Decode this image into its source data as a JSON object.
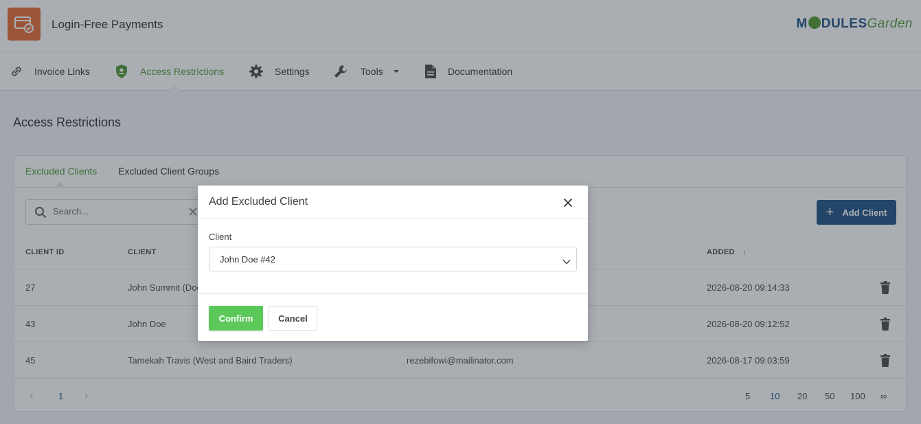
{
  "header": {
    "app_title": "Login-Free Payments",
    "brand_left": "M",
    "brand_mid": "DULES",
    "brand_right": "Garden"
  },
  "nav": {
    "items": [
      {
        "label": "Invoice Links",
        "icon": "link-icon"
      },
      {
        "label": "Access Restrictions",
        "icon": "shield-user-icon",
        "active": true
      },
      {
        "label": "Settings",
        "icon": "gear-icon"
      },
      {
        "label": "Tools",
        "icon": "wrench-icon",
        "dropdown": true
      },
      {
        "label": "Documentation",
        "icon": "document-icon"
      }
    ]
  },
  "page_title": "Access Restrictions",
  "tabs": [
    {
      "label": "Excluded Clients",
      "active": true
    },
    {
      "label": "Excluded Client Groups"
    }
  ],
  "search": {
    "placeholder": "Search..."
  },
  "add_button": "Add Client",
  "table": {
    "headers": [
      "CLIENT ID",
      "CLIENT",
      "ADDED"
    ],
    "rows": [
      {
        "id": "27",
        "client": "John Summit (Doe",
        "email": "",
        "added": "2026-08-20 09:14:33"
      },
      {
        "id": "43",
        "client": "John Doe",
        "email": "",
        "added": "2026-08-20 09:12:52"
      },
      {
        "id": "45",
        "client": "Tamekah Travis (West and Baird Traders)",
        "email": "rezebifowi@mailinator.com",
        "added": "2026-08-17 09:03:59"
      }
    ]
  },
  "pagination": {
    "current": "1",
    "page_sizes": [
      "5",
      "10",
      "20",
      "50",
      "100",
      "∞"
    ],
    "selected_size": "10"
  },
  "modal": {
    "title": "Add Excluded Client",
    "field_label": "Client",
    "selected_client": "John Doe #42",
    "confirm": "Confirm",
    "cancel": "Cancel"
  },
  "colors": {
    "accent_green": "#5a9e3c",
    "primary_blue": "#2c5d8a",
    "confirm_green": "#5cc85a",
    "logo_orange": "#e8743f"
  }
}
